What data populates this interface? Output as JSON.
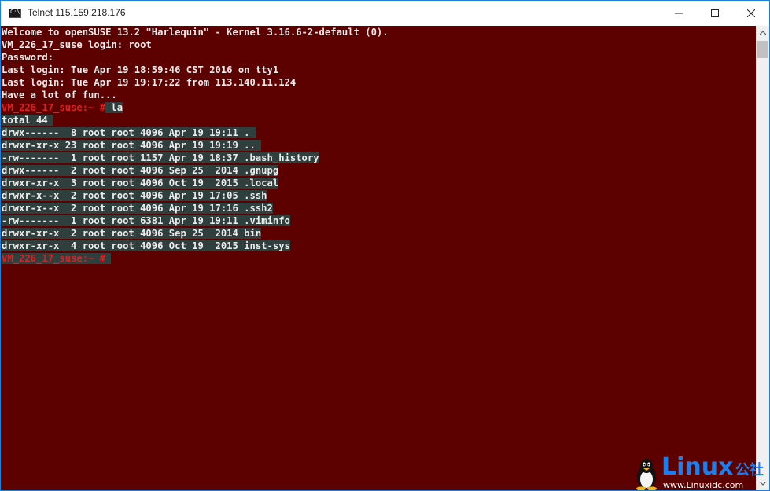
{
  "window": {
    "title": "Telnet 115.159.218.176"
  },
  "terminal": {
    "lines": [
      {
        "text": "Welcome to openSUSE 13.2 \"Harlequin\" - Kernel 3.16.6-2-default (0).",
        "type": "normal"
      },
      {
        "text": "VM_226_17_suse login: root",
        "type": "normal"
      },
      {
        "text": "Password:",
        "type": "normal"
      },
      {
        "text": "Last login: Tue Apr 19 18:59:46 CST 2016 on tty1",
        "type": "normal"
      },
      {
        "text": "Last login: Tue Apr 19 19:17:22 from 113.140.11.124",
        "type": "normal"
      },
      {
        "text": "Have a lot of fun...",
        "type": "normal"
      },
      {
        "prompt": "VM_226_17_suse:~ #",
        "command": " la",
        "type": "prompt-command"
      },
      {
        "text": "total 44 ",
        "type": "selected"
      },
      {
        "text": "drwx------  8 root root 4096 Apr 19 19:11 . ",
        "type": "selected"
      },
      {
        "text": "drwxr-xr-x 23 root root 4096 Apr 19 19:19 .. ",
        "type": "selected"
      },
      {
        "text": "-rw-------  1 root root 1157 Apr 19 18:37 .bash_history",
        "type": "selected"
      },
      {
        "text": "drwx------  2 root root 4096 Sep 25  2014 .gnupg",
        "type": "selected"
      },
      {
        "text": "drwxr-xr-x  3 root root 4096 Oct 19  2015 .local",
        "type": "selected"
      },
      {
        "text": "drwxr-x--x  2 root root 4096 Apr 19 17:05 .ssh",
        "type": "selected"
      },
      {
        "text": "drwxr-x--x  2 root root 4096 Apr 19 17:16 .ssh2",
        "type": "selected"
      },
      {
        "text": "-rw-------  1 root root 6381 Apr 19 19:11 .viminfo",
        "type": "selected"
      },
      {
        "text": "drwxr-xr-x  2 root root 4096 Sep 25  2014 bin",
        "type": "selected"
      },
      {
        "text": "drwxr-xr-x  4 root root 4096 Oct 19  2015 inst-sys",
        "type": "selected"
      },
      {
        "prompt": "VM_226_17_suse:~ #",
        "command": " ",
        "type": "prompt-selected"
      }
    ]
  },
  "watermark": {
    "brand": "Linux",
    "cn": "公社",
    "url": "www.Linuxidc.com"
  },
  "colors": {
    "terminal_bg": "#5c0000",
    "text": "#ececec",
    "prompt": "#e02020",
    "selection": "#2f3f3e",
    "accent": "#1c7ff0"
  },
  "icons": {
    "app": "console-icon",
    "minimize": "minimize-icon",
    "maximize": "maximize-icon",
    "close": "close-icon"
  }
}
